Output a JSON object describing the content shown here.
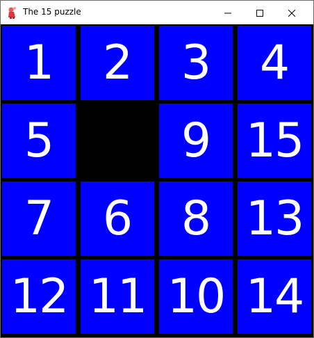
{
  "window": {
    "title": "The 15 puzzle",
    "icon": "app-mascot-icon",
    "buttons": [
      "minimize-icon",
      "maximize-icon",
      "close-icon"
    ]
  },
  "colors": {
    "tile": "#0000ff",
    "tile_text": "#ffffff",
    "blank": "#000000",
    "board_gap": "#000000"
  },
  "board": {
    "rows": 4,
    "cols": 4,
    "tiles": [
      [
        "1",
        "2",
        "3",
        "4"
      ],
      [
        "5",
        "",
        "9",
        "15"
      ],
      [
        "7",
        "6",
        "8",
        "13"
      ],
      [
        "12",
        "11",
        "10",
        "14"
      ]
    ]
  }
}
